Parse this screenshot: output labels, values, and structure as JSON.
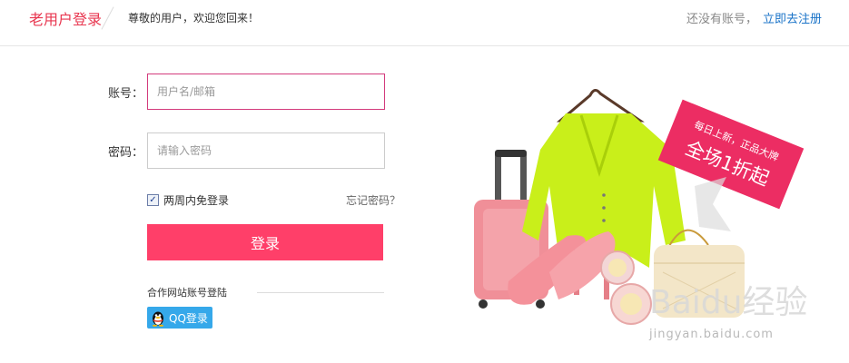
{
  "header": {
    "title": "老用户登录",
    "welcome": "尊敬的用户，欢迎您回来！",
    "no_account": "还没有账号，",
    "register_link": "立即去注册"
  },
  "form": {
    "account_label": "账号：",
    "account_placeholder": "用户名/邮箱",
    "password_label": "密码：",
    "password_placeholder": "请输入密码",
    "remember_label": "两周内免登录",
    "remember_checked": true,
    "forgot_link": "忘记密码？",
    "login_button": "登录"
  },
  "partner": {
    "title": "合作网站账号登陆",
    "qq_button": "QQ登录"
  },
  "promo": {
    "ribbon_line1": "每日上新，正品大牌",
    "ribbon_line2": "全场1折起",
    "watermark_logo": "Baidu经验",
    "watermark_url": "jingyan.baidu.com"
  },
  "colors": {
    "accent": "#ff3f69",
    "title": "#e8364f",
    "link": "#1a73c8",
    "qq": "#35a8ea"
  }
}
